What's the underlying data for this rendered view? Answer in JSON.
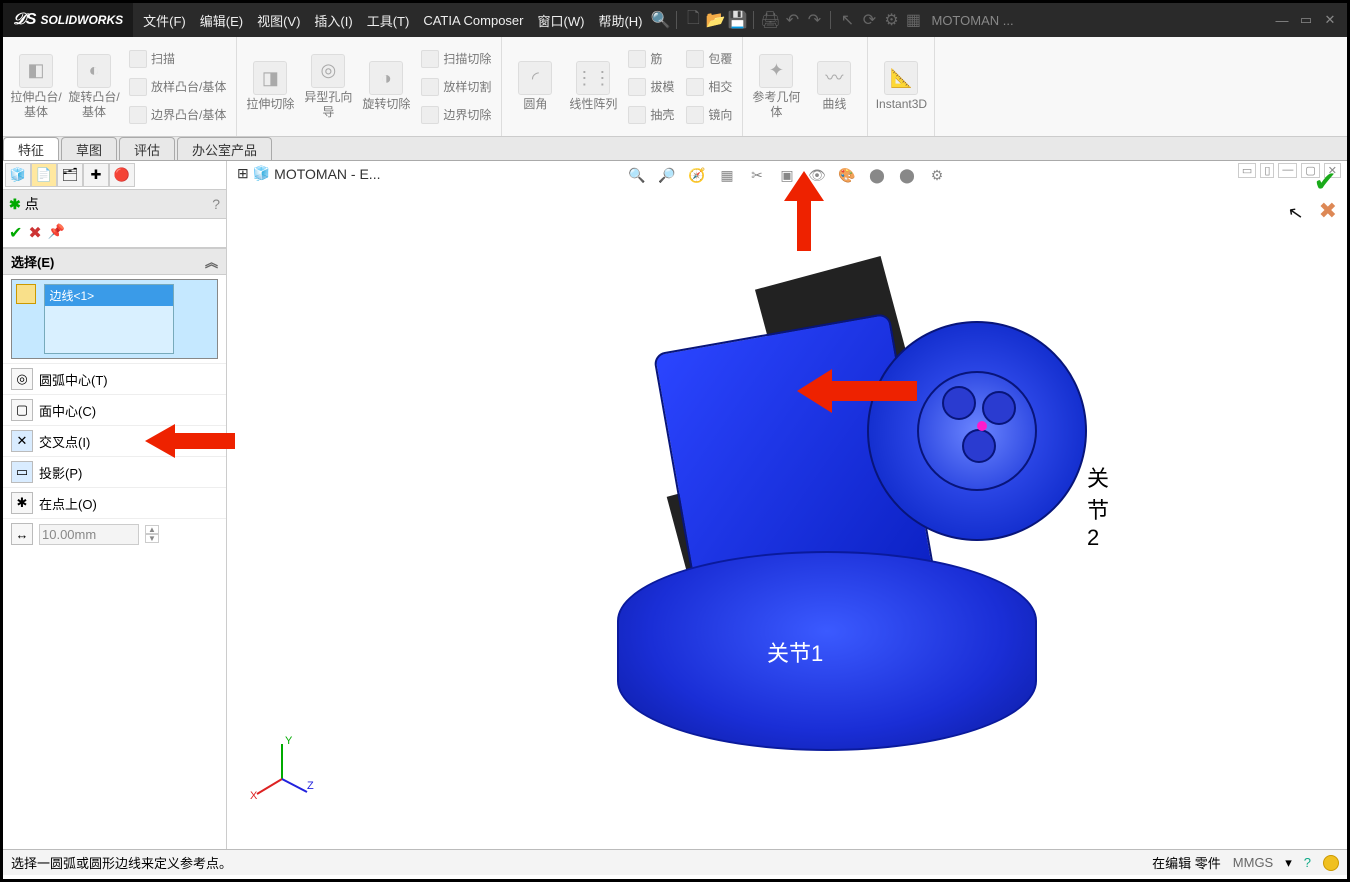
{
  "app": {
    "name": "SOLIDWORKS",
    "doc_title": "MOTOMAN ..."
  },
  "menu": {
    "file": "文件(F)",
    "edit": "编辑(E)",
    "view": "视图(V)",
    "insert": "插入(I)",
    "tools": "工具(T)",
    "catia": "CATIA Composer",
    "window": "窗口(W)",
    "help": "帮助(H)"
  },
  "ribbon": {
    "extrude_boss": "拉伸凸台/基体",
    "revolve_boss": "旋转凸台/基体",
    "sweep": "扫描",
    "loft_boss": "放样凸台/基体",
    "boundary_boss": "边界凸台/基体",
    "extrude_cut": "拉伸切除",
    "hole_wizard": "异型孔向导",
    "revolve_cut": "旋转切除",
    "sweep_cut": "扫描切除",
    "loft_cut": "放样切割",
    "boundary_cut": "边界切除",
    "fillet": "圆角",
    "linear_pattern": "线性阵列",
    "rib": "筋",
    "draft": "拔模",
    "shell": "抽壳",
    "wrap": "包覆",
    "intersect": "相交",
    "mirror": "镜向",
    "ref_geom": "参考几何体",
    "curves": "曲线",
    "instant3d": "Instant3D"
  },
  "tabs": {
    "feature": "特征",
    "sketch": "草图",
    "evaluate": "评估",
    "office": "办公室产品"
  },
  "crumb": {
    "label": "MOTOMAN - E..."
  },
  "pm": {
    "title": "点",
    "section_select": "选择(E)",
    "sel_item": "边线<1>",
    "opt_arc_center": "圆弧中心(T)",
    "opt_face_center": "面中心(C)",
    "opt_intersection": "交叉点(I)",
    "opt_projection": "投影(P)",
    "opt_on_point": "在点上(O)",
    "distance_value": "10.00mm"
  },
  "annotations": {
    "joint1": "关节1",
    "joint2": "关节2"
  },
  "status": {
    "hint": "选择一圆弧或圆形边线来定义参考点。",
    "mode": "在编辑 零件",
    "units": "MMGS"
  }
}
